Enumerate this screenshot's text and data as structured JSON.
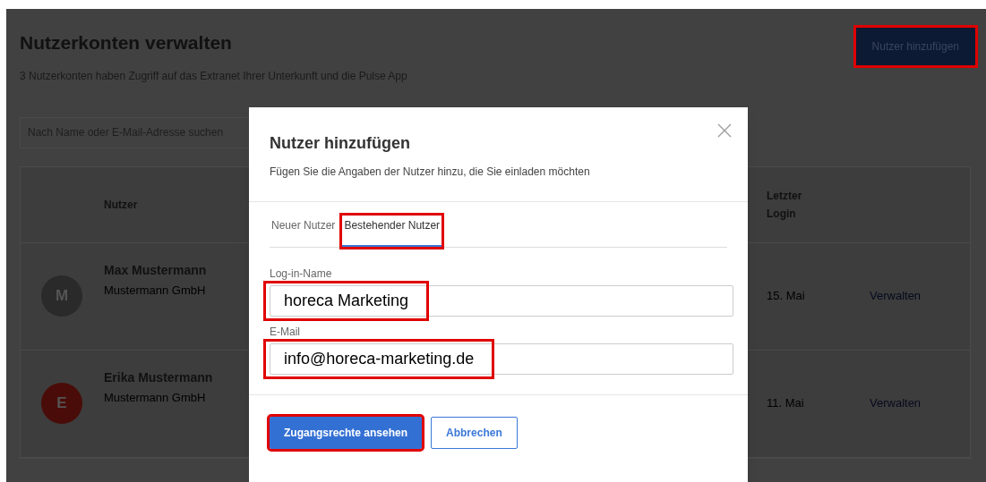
{
  "page": {
    "title": "Nutzerkonten verwalten",
    "subtitle": "3 Nutzerkonten haben Zugriff auf das Extranet Ihrer Unterkunft und die Pulse App",
    "add_button": {
      "label": "Nutzer hinzufügen",
      "highlighted": true
    },
    "search": {
      "placeholder": "Nach Name oder E-Mail-Adresse suchen"
    },
    "table": {
      "columns": [
        "Nutzer",
        "Letzter Login"
      ],
      "rows": [
        {
          "initial": "M",
          "color": "#2a2a2a",
          "name": "Max Mustermann",
          "company": "Mustermann GmbH",
          "last_login": "15. Mai",
          "action": "Verwalten"
        },
        {
          "initial": "E",
          "color": "#4a0c08",
          "name": "Erika Mustermann",
          "company": "Mustermann GmbH",
          "last_login": "11. Mai",
          "action": "Verwalten"
        }
      ]
    }
  },
  "dialog": {
    "title": "Nutzer hinzufügen",
    "subtitle": "Fügen Sie die Angaben der Nutzer hinzu, die Sie einladen möchten",
    "tabs": [
      {
        "label": "Neuer Nutzer",
        "selected": false,
        "highlighted": false
      },
      {
        "label": "Bestehender Nutzer",
        "selected": true,
        "highlighted": true
      }
    ],
    "fields": [
      {
        "label": "Log-in-Name",
        "value": "horeca Marketing",
        "highlighted": true
      },
      {
        "label": "E-Mail",
        "value": "info@horeca-marketing.de",
        "highlighted": true
      }
    ],
    "buttons": [
      {
        "kind": "primary",
        "label": "Zugangsrechte ansehen",
        "highlighted": true
      },
      {
        "kind": "secondary",
        "label": "Abbrechen",
        "highlighted": false
      }
    ]
  }
}
